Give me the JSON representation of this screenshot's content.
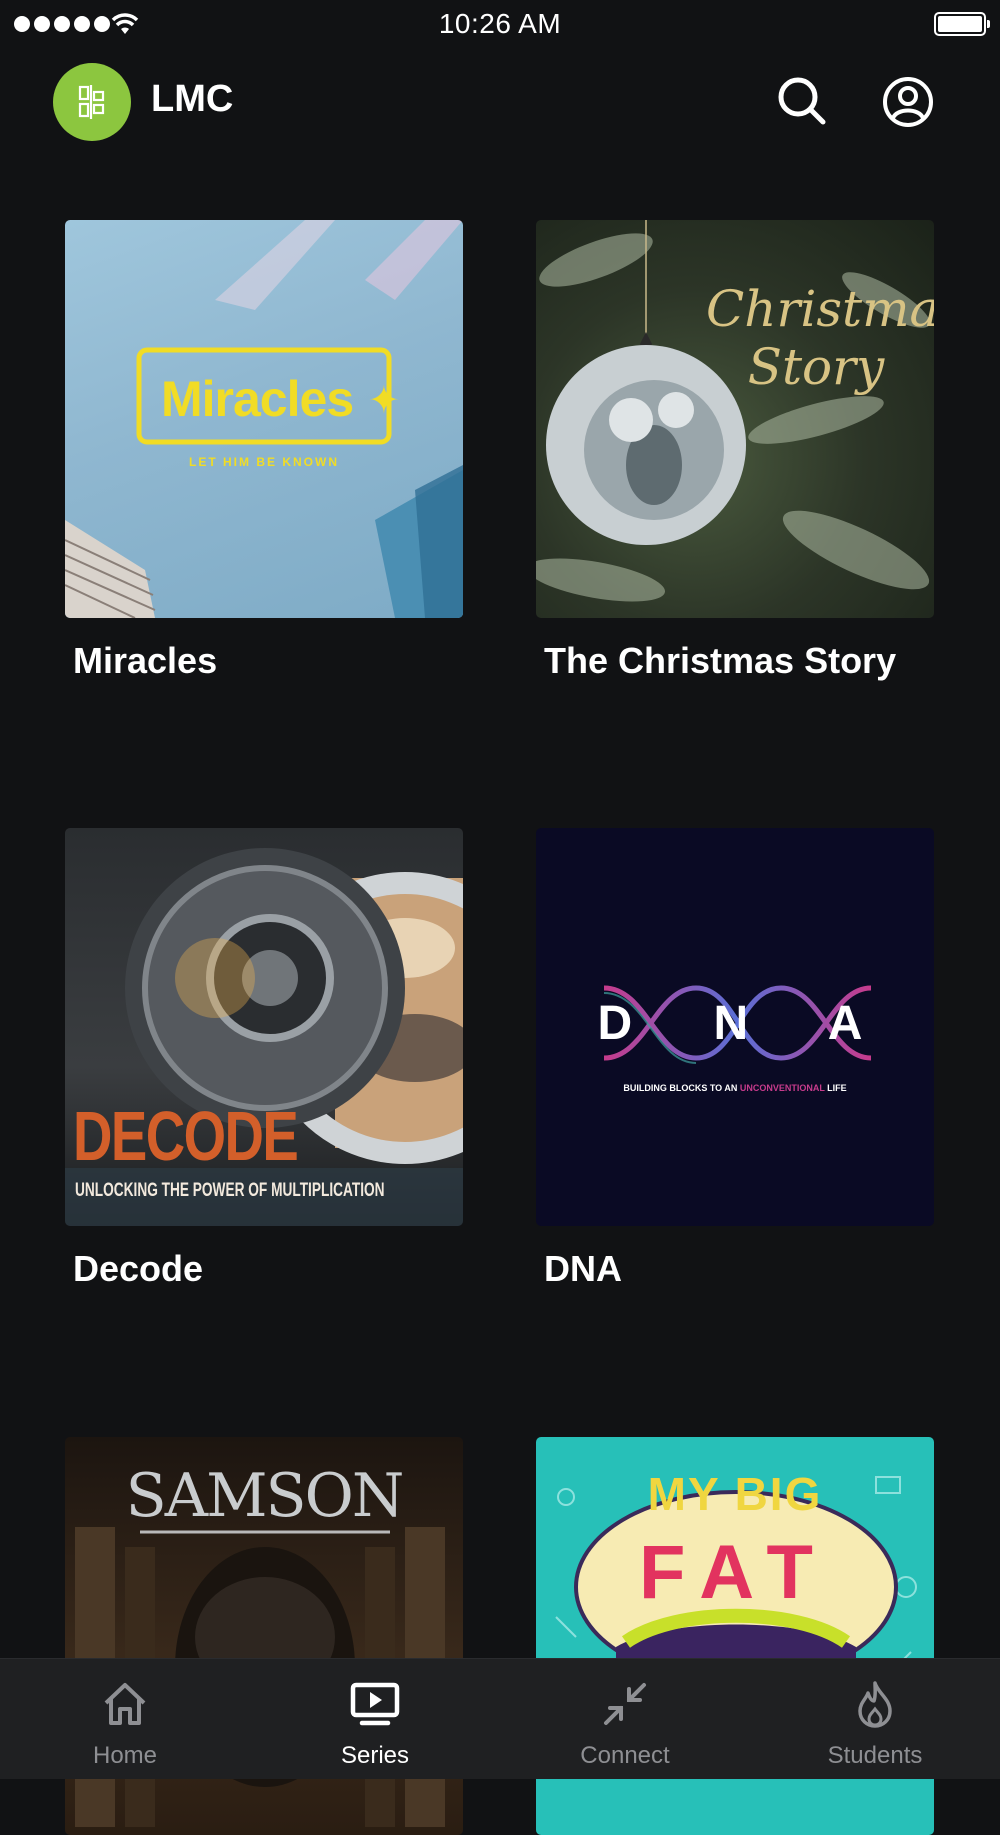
{
  "status_bar": {
    "time": "10:26 AM"
  },
  "header": {
    "brand": "LMC"
  },
  "series": [
    {
      "title": "Miracles",
      "art_text": "Miracles",
      "art_subtext": "LET HIM BE KNOWN"
    },
    {
      "title": "The Christmas Story",
      "art_text": "Christmas Story"
    },
    {
      "title": "Decode",
      "art_text": "DECODE",
      "art_subtext": "UNLOCKING THE POWER OF MULTIPLICATION"
    },
    {
      "title": "DNA",
      "art_text": "D N A",
      "art_subtext_a": "BUILDING BLOCKS TO AN ",
      "art_subtext_b": "UNCONVENTIONAL",
      "art_subtext_c": " LIFE"
    },
    {
      "art_text": "SAMSON"
    },
    {
      "art_text_1": "MY BIG",
      "art_text_2": "FAT"
    }
  ],
  "tabs": [
    {
      "label": "Home",
      "icon": "home-icon"
    },
    {
      "label": "Series",
      "icon": "tv-icon",
      "active": true
    },
    {
      "label": "Connect",
      "icon": "connect-icon"
    },
    {
      "label": "Students",
      "icon": "flame-icon"
    }
  ],
  "colors": {
    "accent": "#8cc63f",
    "background": "#111214",
    "tabbar": "#1f2022"
  }
}
